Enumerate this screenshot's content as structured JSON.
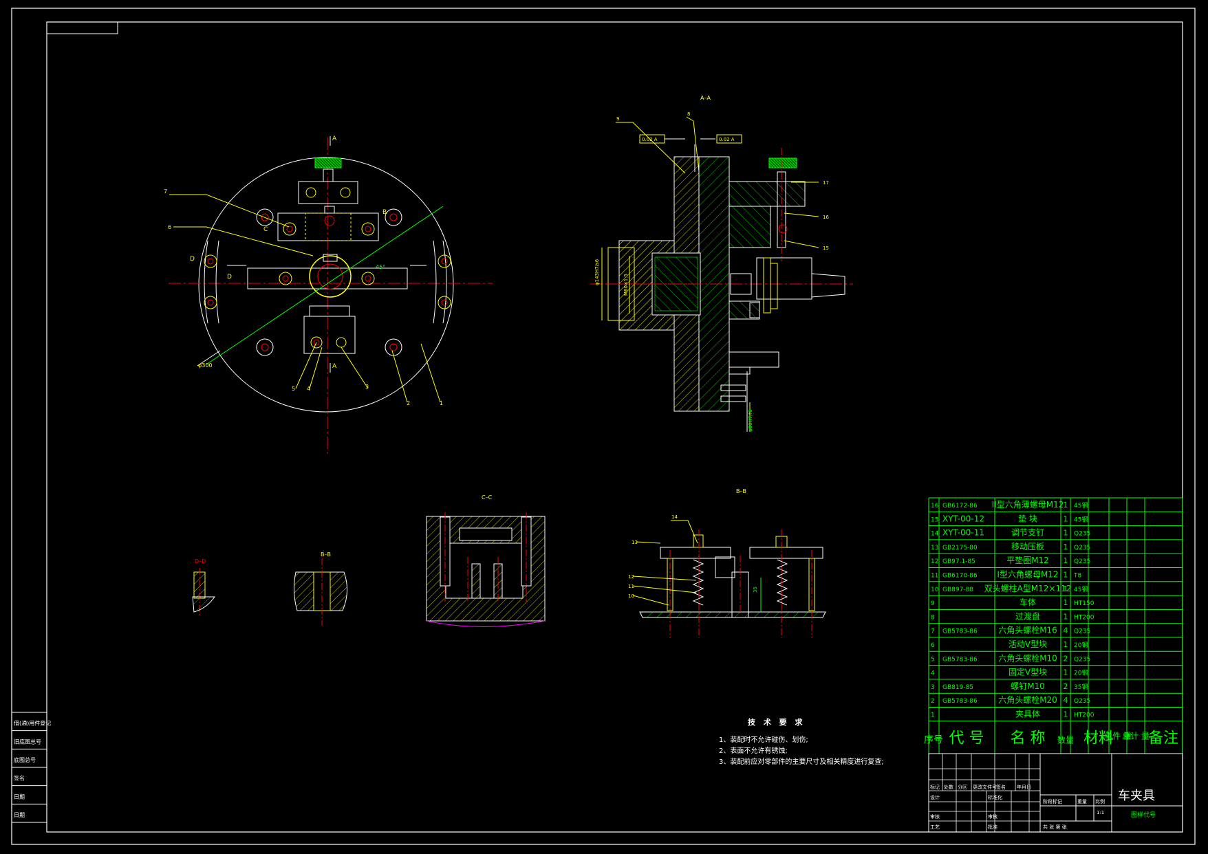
{
  "drawing": {
    "views": {
      "main_section": "A–A",
      "section_bb": "B–B",
      "section_cc": "C–C",
      "section_dd": "D–D",
      "section_bb_small": "B–B"
    },
    "left_view_labels": {
      "mark_a_top": "A",
      "mark_a_bottom": "A",
      "mark_b": "B",
      "mark_c": "C",
      "mark_d_left": "D",
      "mark_d_right": "D",
      "angle": "45°",
      "dia_label": "φ300",
      "c_mark": "C",
      "callout_7": "7",
      "callout_6": "6",
      "callout_5": "5",
      "callout_4": "4",
      "callout_3": "3",
      "callout_2": "2",
      "callout_1": "1"
    },
    "right_view_labels": {
      "callout_9": "9",
      "callout_8": "8",
      "callout_17": "17",
      "callout_16": "16",
      "callout_15": "15",
      "tol_left": "0.02 A",
      "tol_right": "0.02 A",
      "dim_vertical": "φ143H7/s6",
      "dim_inner": "M60×1.5",
      "dim_bottom": "φ80H7/f6"
    },
    "section_labels": {
      "dim_35": "35",
      "callout_14": "14",
      "callout_13": "13",
      "callout_12": "12",
      "callout_11": "11",
      "callout_10": "10"
    }
  },
  "tech_requirements": {
    "title": "技 术 要 求",
    "items": [
      "1、装配时不允许碰伤、划伤;",
      "2、表面不允许有锈蚀;",
      "3、装配前应对零部件的主要尺寸及相关精度进行复查;"
    ]
  },
  "bom": {
    "rows": [
      {
        "no": "16",
        "code": "GB6172-86",
        "name": "II型六角薄螺母M12",
        "qty": "1",
        "material": "45钢"
      },
      {
        "no": "15",
        "code": "XYT-00-12",
        "name": "垫 块",
        "qty": "1",
        "material": "45钢"
      },
      {
        "no": "14",
        "code": "XYT-00-11",
        "name": "调节支钉",
        "qty": "1",
        "material": "Q235"
      },
      {
        "no": "13",
        "code": "GB2175-80",
        "name": "移动压板",
        "qty": "1",
        "material": "Q235"
      },
      {
        "no": "12",
        "code": "GB97.1-85",
        "name": "平垫圈M12",
        "qty": "1",
        "material": "Q235"
      },
      {
        "no": "11",
        "code": "GB6170-86",
        "name": "I型六角螺母M12",
        "qty": "1",
        "material": "T8"
      },
      {
        "no": "10",
        "code": "GB897-88",
        "name": "双头螺柱A型M12×112",
        "qty": "1",
        "material": "45钢"
      },
      {
        "no": "9",
        "code": "",
        "name": "车体",
        "qty": "1",
        "material": "HT150"
      },
      {
        "no": "8",
        "code": "",
        "name": "过渡盘",
        "qty": "1",
        "material": "HT200"
      },
      {
        "no": "7",
        "code": "GB5783-86",
        "name": "六角头螺栓M16",
        "qty": "4",
        "material": "Q235"
      },
      {
        "no": "6",
        "code": "",
        "name": "活动V型块",
        "qty": "1",
        "material": "20钢"
      },
      {
        "no": "5",
        "code": "GB5783-86",
        "name": "六角头螺栓M10",
        "qty": "2",
        "material": "Q235"
      },
      {
        "no": "4",
        "code": "",
        "name": "固定V型块",
        "qty": "1",
        "material": "20钢"
      },
      {
        "no": "3",
        "code": "GB819-85",
        "name": "螺钉M10",
        "qty": "2",
        "material": "35钢"
      },
      {
        "no": "2",
        "code": "GB5783-86",
        "name": "六角头螺栓M20",
        "qty": "4",
        "material": "Q235"
      },
      {
        "no": "1",
        "code": "",
        "name": "夹具体",
        "qty": "1",
        "material": "HT200"
      }
    ],
    "header": {
      "no": "序号",
      "code": "代 号",
      "name": "名 称",
      "qty": "数量",
      "material": "材料",
      "unit_weight": "单件 重",
      "total_weight": "总计 量",
      "remark": "备注"
    }
  },
  "title_block": {
    "title": "车夹具",
    "drawing_code": "图样代号",
    "ratio": "1:1",
    "ratio_label": "比例",
    "weight_label": "重量",
    "stage_label": "阶段标记",
    "sheet_info": "共   张   第   张",
    "labels": {
      "mark": "标记",
      "count": "处数",
      "zone": "分区",
      "change_doc": "更改文件号",
      "sign": "签名",
      "date": "年月日",
      "design": "设计",
      "standard": "标准化",
      "draw": "审核",
      "process": "工艺",
      "approve": "批准",
      "check": "审核"
    }
  },
  "side_block": {
    "items": [
      "借(通)用件登记",
      "旧底图总号",
      "底图总号",
      "签名",
      "日期",
      "日期"
    ]
  },
  "colors": {
    "frame": "#ffffff",
    "bom_green": "#00ff00",
    "part_yellow": "#ffff00",
    "center_red": "#ff0000",
    "hatch_green": "#00c800",
    "magenta": "#ff00ff",
    "knurl_green": "#00a000"
  }
}
